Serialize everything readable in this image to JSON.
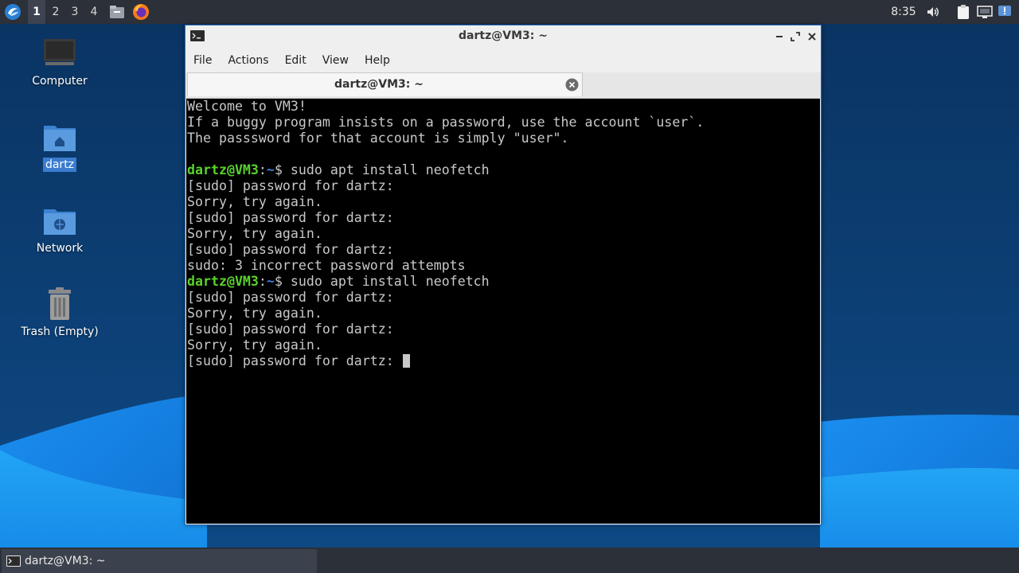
{
  "top_panel": {
    "workspaces": [
      "1",
      "2",
      "3",
      "4"
    ],
    "active_workspace": "1",
    "clock": "8:35",
    "launchers": [
      "file-manager-icon",
      "firefox-icon"
    ],
    "tray_icons": [
      "volume-icon",
      "clipboard-icon",
      "network-icon",
      "notification-icon"
    ]
  },
  "desktop": {
    "icons": [
      {
        "label": "Computer",
        "icon": "computer-icon"
      },
      {
        "label": "dartz",
        "icon": "home-folder-icon",
        "selected": true
      },
      {
        "label": "Network",
        "icon": "network-folder-icon"
      },
      {
        "label": "Trash (Empty)",
        "icon": "trash-icon"
      }
    ]
  },
  "window": {
    "title": "dartz@VM3: ~",
    "menu": [
      "File",
      "Actions",
      "Edit",
      "View",
      "Help"
    ],
    "tab_label": "dartz@VM3: ~",
    "colors": {
      "prompt_user": "#5ad22b",
      "prompt_path": "#3f7fe0",
      "text": "#c8c8c8",
      "background": "#000000"
    }
  },
  "terminal": {
    "lines": [
      {
        "text": "Welcome to VM3!"
      },
      {
        "text": "If a buggy program insists on a password, use the account `user`."
      },
      {
        "text": "The passsword for that account is simply \"user\"."
      },
      {
        "text": ""
      },
      {
        "prompt_user": "dartz@VM3",
        "prompt_sep": ":",
        "prompt_path": "~",
        "text": "$ sudo apt install neofetch"
      },
      {
        "text": "[sudo] password for dartz:"
      },
      {
        "text": "Sorry, try again."
      },
      {
        "text": "[sudo] password for dartz:"
      },
      {
        "text": "Sorry, try again."
      },
      {
        "text": "[sudo] password for dartz:"
      },
      {
        "text": "sudo: 3 incorrect password attempts"
      },
      {
        "prompt_user": "dartz@VM3",
        "prompt_sep": ":",
        "prompt_path": "~",
        "text": "$ sudo apt install neofetch"
      },
      {
        "text": "[sudo] password for dartz:"
      },
      {
        "text": "Sorry, try again."
      },
      {
        "text": "[sudo] password for dartz:"
      },
      {
        "text": "Sorry, try again."
      },
      {
        "text": "[sudo] password for dartz: ",
        "cursor": true
      }
    ]
  },
  "taskbar": {
    "window_label": "dartz@VM3: ~"
  }
}
